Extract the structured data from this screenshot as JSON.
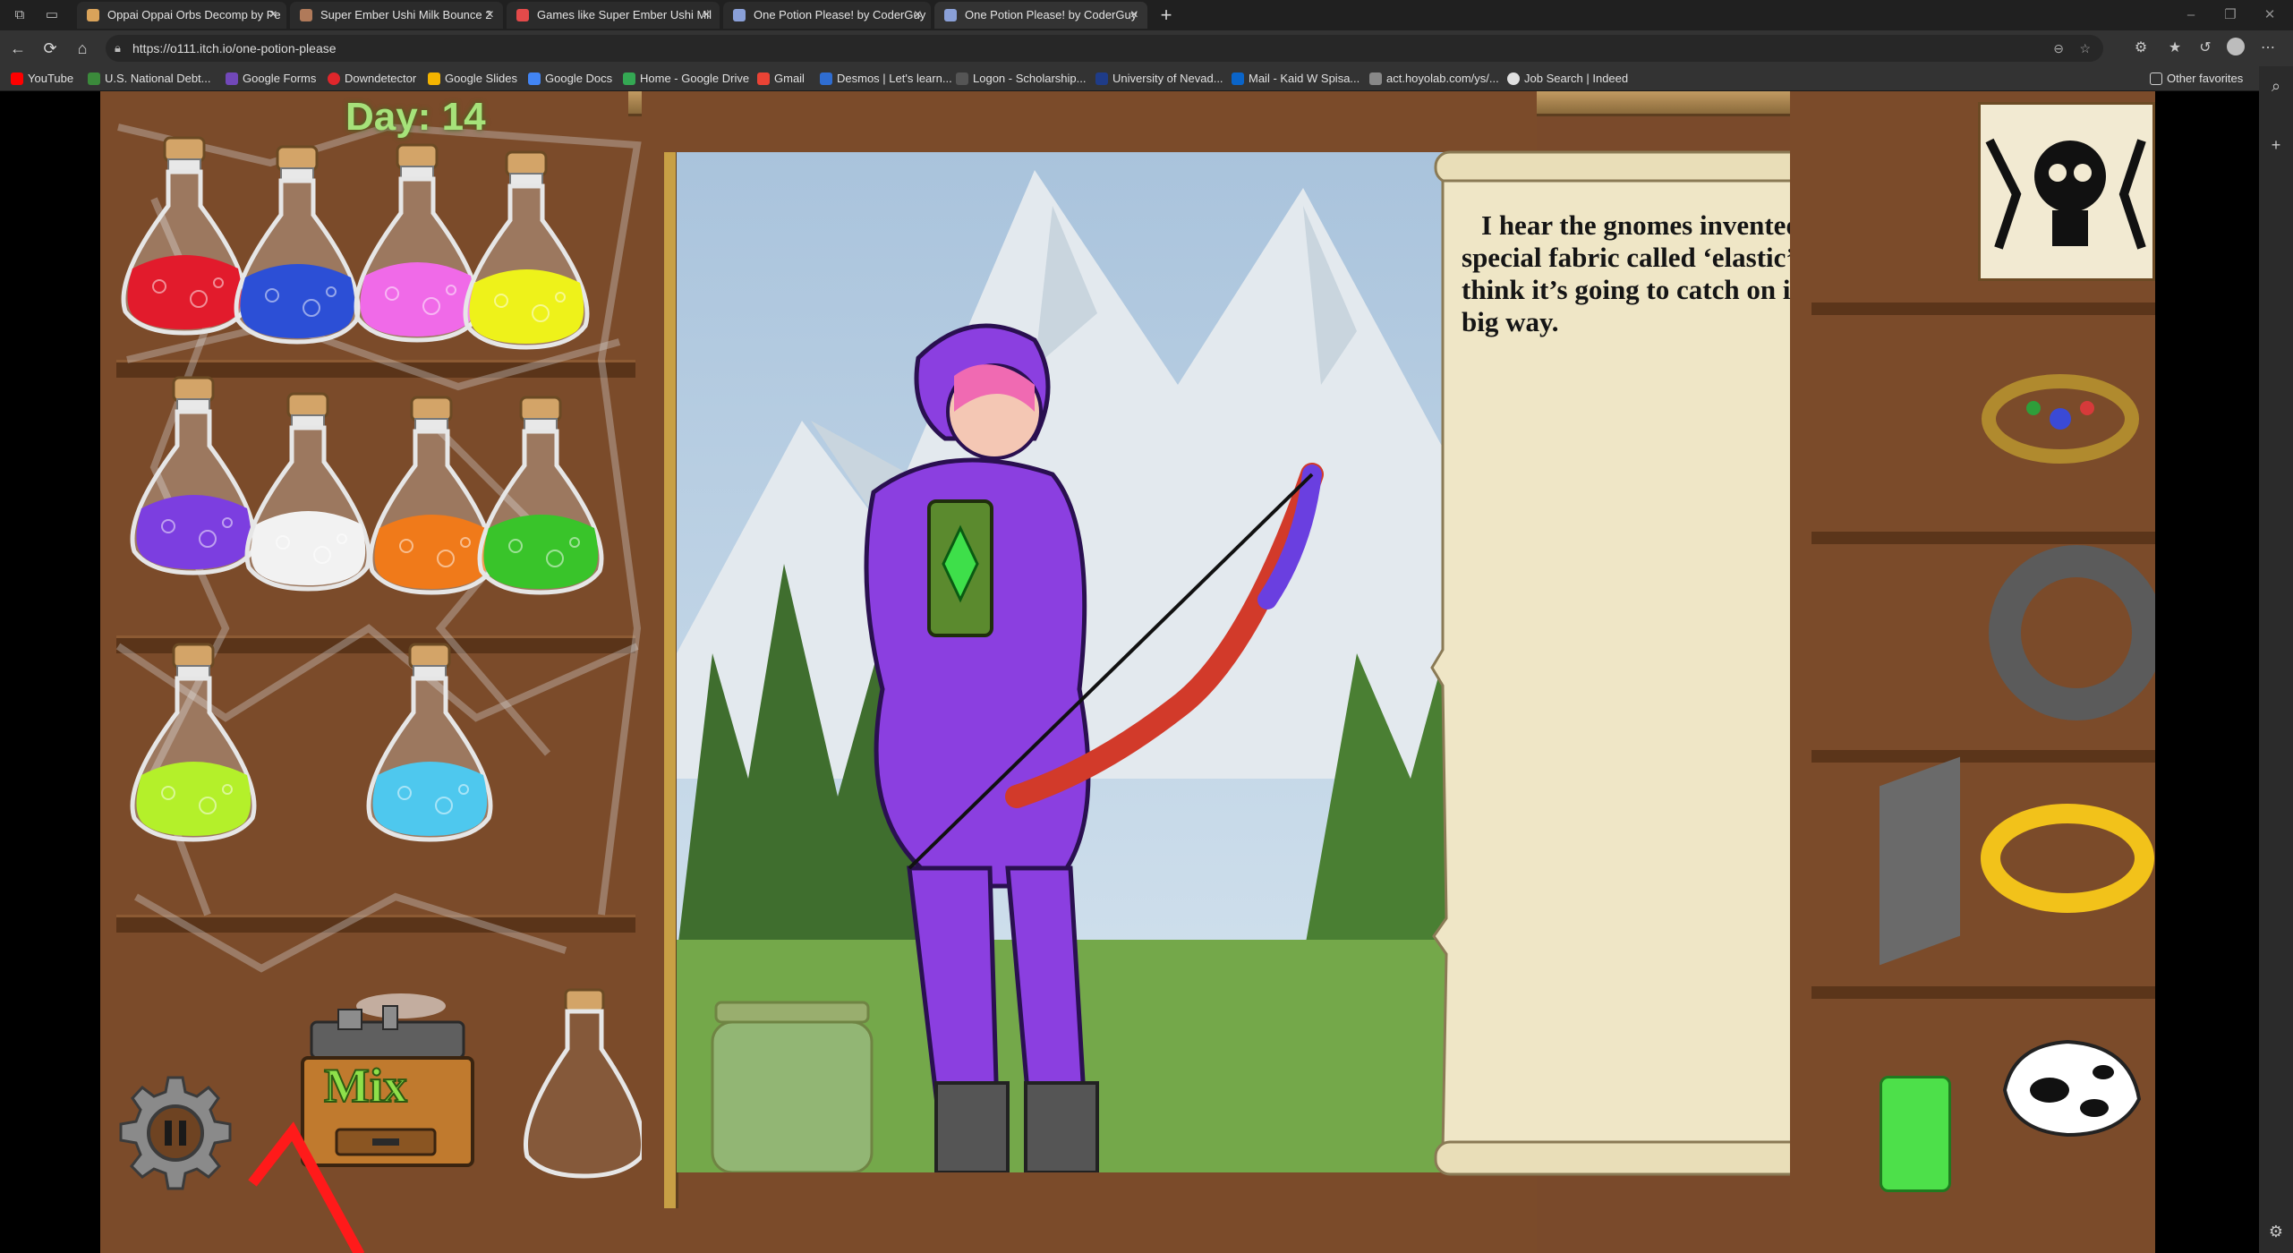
{
  "browser": {
    "tabs": [
      {
        "title": "Oppai Oppai Orbs Decomp by Pe",
        "favicon_color": "#d9a35a",
        "active": false
      },
      {
        "title": "Super Ember Ushi Milk Bounce 2",
        "favicon_color": "#b07a5a",
        "active": false
      },
      {
        "title": "Games like Super Ember Ushi Mil",
        "favicon_color": "#e34a4a",
        "active": false
      },
      {
        "title": "One Potion Please! by CoderGuy",
        "favicon_color": "#8aa0d8",
        "active": false
      },
      {
        "title": "One Potion Please! by CoderGuy",
        "favicon_color": "#8aa0d8",
        "active": true
      }
    ],
    "url": "https://o111.itch.io/one-potion-please",
    "bookmarks": [
      {
        "label": "YouTube",
        "color": "#ff0000"
      },
      {
        "label": "U.S. National Debt...",
        "color": "#3b8a3b"
      },
      {
        "label": "Google Forms",
        "color": "#7248b9"
      },
      {
        "label": "Downdetector",
        "color": "#e0262b"
      },
      {
        "label": "Google Slides",
        "color": "#f4b400"
      },
      {
        "label": "Google Docs",
        "color": "#4285f4"
      },
      {
        "label": "Home - Google Drive",
        "color": "#34a853"
      },
      {
        "label": "Gmail",
        "color": "#ea4335"
      },
      {
        "label": "Desmos | Let's learn...",
        "color": "#2f6dd1"
      },
      {
        "label": "Logon - Scholarship...",
        "color": "#555555"
      },
      {
        "label": "University of Nevad...",
        "color": "#1f3c88"
      },
      {
        "label": "Mail - Kaid W Spisa...",
        "color": "#0a64c8"
      },
      {
        "label": "act.hoyolab.com/ys/...",
        "color": "#888888"
      },
      {
        "label": "Job Search | Indeed",
        "color": "#e0e0e0"
      }
    ],
    "other_favorites": "Other favorites"
  },
  "game": {
    "day_label": "Day: 14",
    "mix_label": "Mix",
    "dialogue": "I hear the gnomes invented a special fabric called ‘elastic’. I think it’s going to catch on in a big way.",
    "potions": [
      {
        "name": "red",
        "color": "#e21b2c"
      },
      {
        "name": "blue",
        "color": "#2c4fd6"
      },
      {
        "name": "pink",
        "color": "#f06ae8"
      },
      {
        "name": "yellow",
        "color": "#eef21a"
      },
      {
        "name": "purple",
        "color": "#7c3ee0"
      },
      {
        "name": "white",
        "color": "#f2f2f2"
      },
      {
        "name": "orange",
        "color": "#f07a1a"
      },
      {
        "name": "green",
        "color": "#39c42a"
      },
      {
        "name": "lime",
        "color": "#b4f02a"
      },
      {
        "name": "cyan",
        "color": "#4ec8ee"
      }
    ],
    "colors": {
      "wood": "#7b4b2a",
      "wood_dark": "#5a3419",
      "parchment": "#efe6c6",
      "day_text": "#a6e27a",
      "character_suit": "#8b3fe0"
    }
  }
}
